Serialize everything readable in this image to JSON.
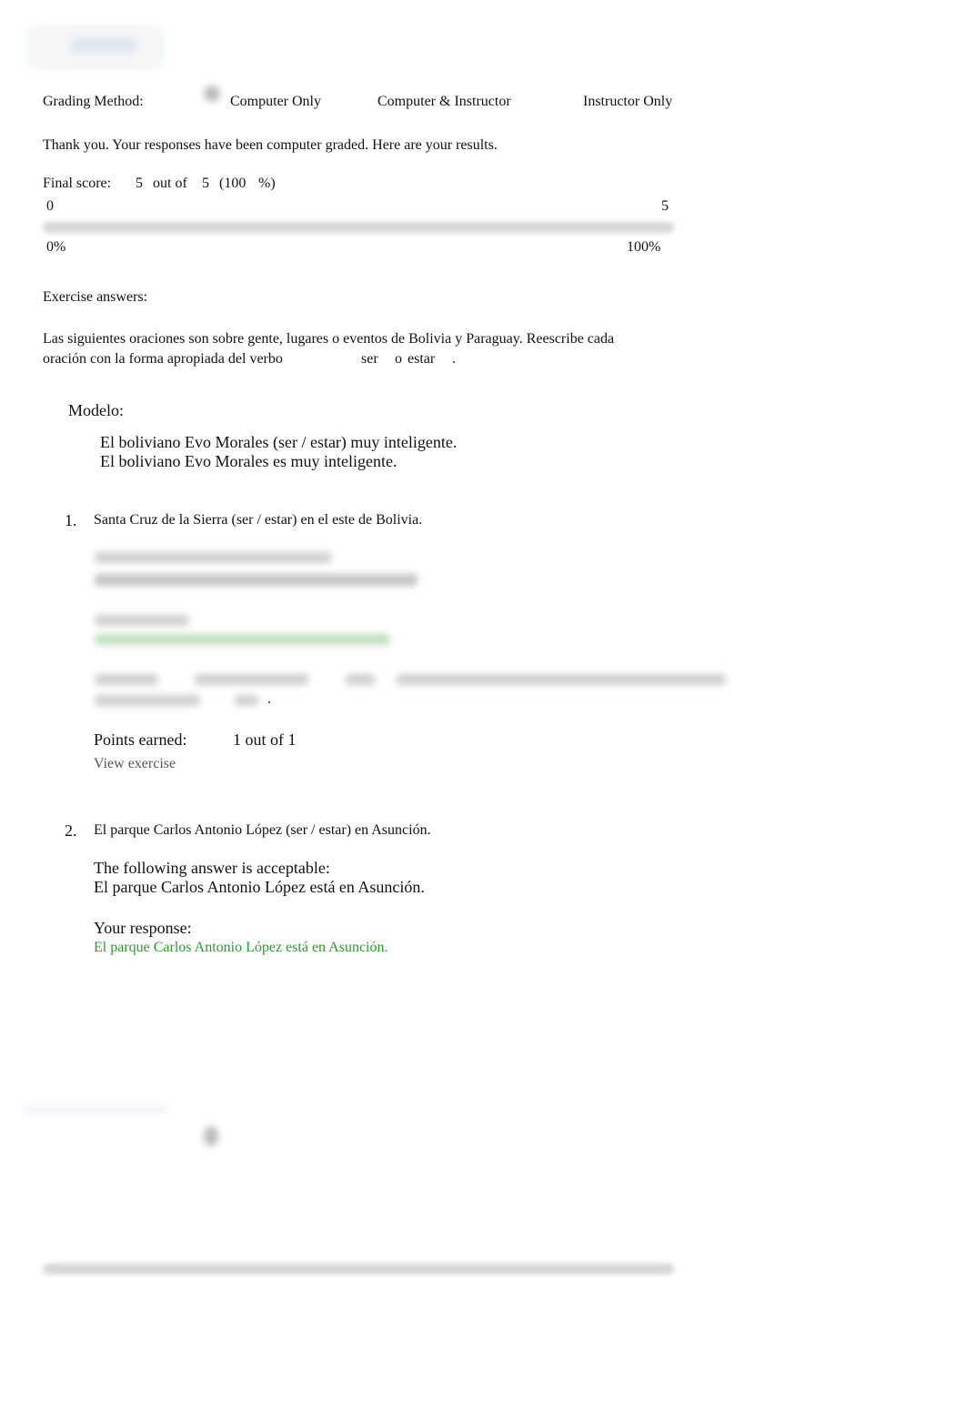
{
  "header": {
    "logo_icon": "blurred-logo"
  },
  "grading": {
    "label": "Grading Method:",
    "options": [
      "Computer Only",
      "Computer & Instructor",
      "Instructor Only"
    ],
    "selected": "Computer Only"
  },
  "thanks": "Thank you. Your responses have been computer graded. Here are your results.",
  "score": {
    "label": "Final score:",
    "earned": "5",
    "out_of": "out of",
    "total": "5",
    "percent_open": "(100",
    "percent_close": "%)",
    "scale_min": "0",
    "scale_max": "5",
    "pct_min": "0%",
    "pct_max": "100%",
    "progress_percent": 100
  },
  "exercise_answers_label": "Exercise answers:",
  "instructions": {
    "line1": "Las siguientes oraciones son sobre gente, lugares o eventos de Bolivia y Paraguay. Reescribe cada",
    "line2": "oración con la forma apropiada del verbo",
    "verb1": "ser",
    "or": "o",
    "verb2": "estar",
    "period": "."
  },
  "model": {
    "label": "Modelo:",
    "prompt": "El boliviano Evo Morales (ser / estar) muy inteligente.",
    "answer": "El boliviano Evo Morales es muy inteligente."
  },
  "questions": [
    {
      "number": "1.",
      "prompt": "Santa Cruz de la Sierra (ser / estar) en el este de Bolivia.",
      "period": ".",
      "points_label": "Points earned:",
      "points_value": "1 out of 1",
      "view_link": "View exercise"
    },
    {
      "number": "2.",
      "prompt": "El parque Carlos Antonio López (ser / estar) en Asunción.",
      "acceptable_label": "The following answer is acceptable:",
      "acceptable_answer": "El parque Carlos Antonio López está en Asunción.",
      "response_label": "Your response:",
      "response": "El parque Carlos Antonio López está en Asunción."
    }
  ],
  "colors": {
    "correct": "#2a9a2a",
    "bar": "#d6d6d6"
  }
}
